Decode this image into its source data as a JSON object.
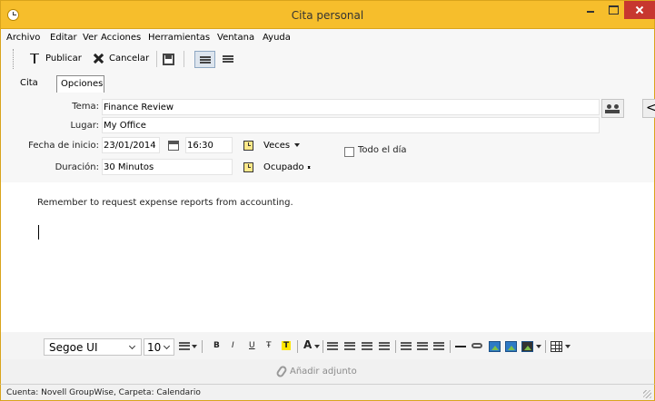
{
  "window": {
    "title": "Cita personal"
  },
  "menu": [
    "Archivo",
    "Editar",
    "Ver",
    "Acciones",
    "Herramientas",
    "Ventana",
    "Ayuda"
  ],
  "toolbar": {
    "publish_label": "Publicar",
    "cancel_label": "Cancelar"
  },
  "tabs": [
    {
      "label": "Cita",
      "active": true
    },
    {
      "label": "Opciones",
      "active": false
    }
  ],
  "form": {
    "subject_label": "Tema:",
    "subject_value": "Finance Review",
    "location_label": "Lugar:",
    "location_value": "My Office",
    "start_label": "Fecha de inicio:",
    "start_date": "23/01/2014",
    "start_time": "16:30",
    "recurrence": "Veces",
    "all_day_label": "Todo el día",
    "all_day_checked": false,
    "duration_label": "Duración:",
    "duration_value": "30 Minutos",
    "show_as": "Ocupado"
  },
  "message": {
    "body": "Remember to request expense reports from accounting."
  },
  "format_bar": {
    "font": "Segoe UI",
    "size": "10",
    "bold": "B",
    "italic": "I",
    "underline": "U",
    "strike": "Ŧ",
    "highlight": "T",
    "font_color": "A"
  },
  "attach": {
    "label": "Añadir adjunto"
  },
  "status": {
    "text": "Cuenta: Novell GroupWise,  Carpeta: Calendario"
  },
  "colors": {
    "titlebar": "#f6be2c",
    "close": "#c7372f",
    "highlight": "#ffe600"
  }
}
